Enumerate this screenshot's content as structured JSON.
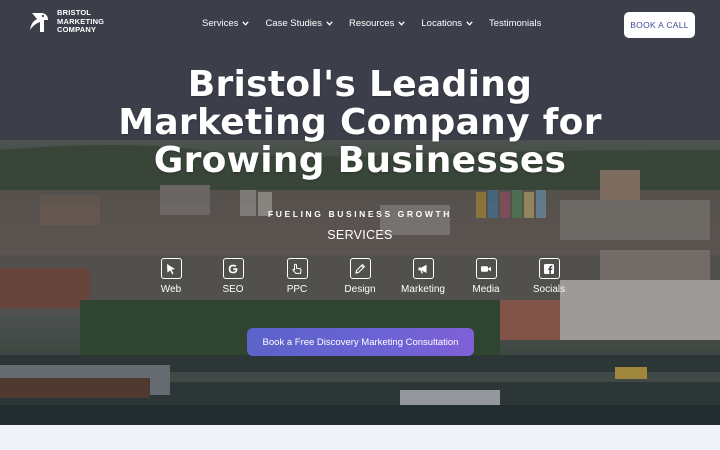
{
  "brand": {
    "line1": "BRISTOL",
    "line2": "MARKETING",
    "line3": "COMPANY"
  },
  "nav": [
    {
      "label": "Services",
      "dropdown": true
    },
    {
      "label": "Case Studies",
      "dropdown": true
    },
    {
      "label": "Resources",
      "dropdown": true
    },
    {
      "label": "Locations",
      "dropdown": true
    },
    {
      "label": "Testimonials",
      "dropdown": false
    }
  ],
  "header_cta": "BOOK A CALL",
  "hero": {
    "headline": [
      "Bristol's Leading",
      "Marketing Company for",
      "Growing Businesses"
    ],
    "tagline": "FUELING BUSINESS GROWTH",
    "services_label": "SERVICES",
    "services": [
      {
        "label": "Web",
        "icon": "cursor-icon"
      },
      {
        "label": "SEO",
        "icon": "google-icon"
      },
      {
        "label": "PPC",
        "icon": "pointer-hand-icon"
      },
      {
        "label": "Design",
        "icon": "pencil-icon"
      },
      {
        "label": "Marketing",
        "icon": "megaphone-icon"
      },
      {
        "label": "Media",
        "icon": "video-camera-icon"
      },
      {
        "label": "Socials",
        "icon": "facebook-icon"
      }
    ],
    "cta": "Book a Free Discovery Marketing Consultation"
  },
  "colors": {
    "accent": "#5b63c9",
    "accent_end": "#7e5fd6",
    "cta_text": "#3f4a9c",
    "page_bg": "#f1f3fa"
  }
}
